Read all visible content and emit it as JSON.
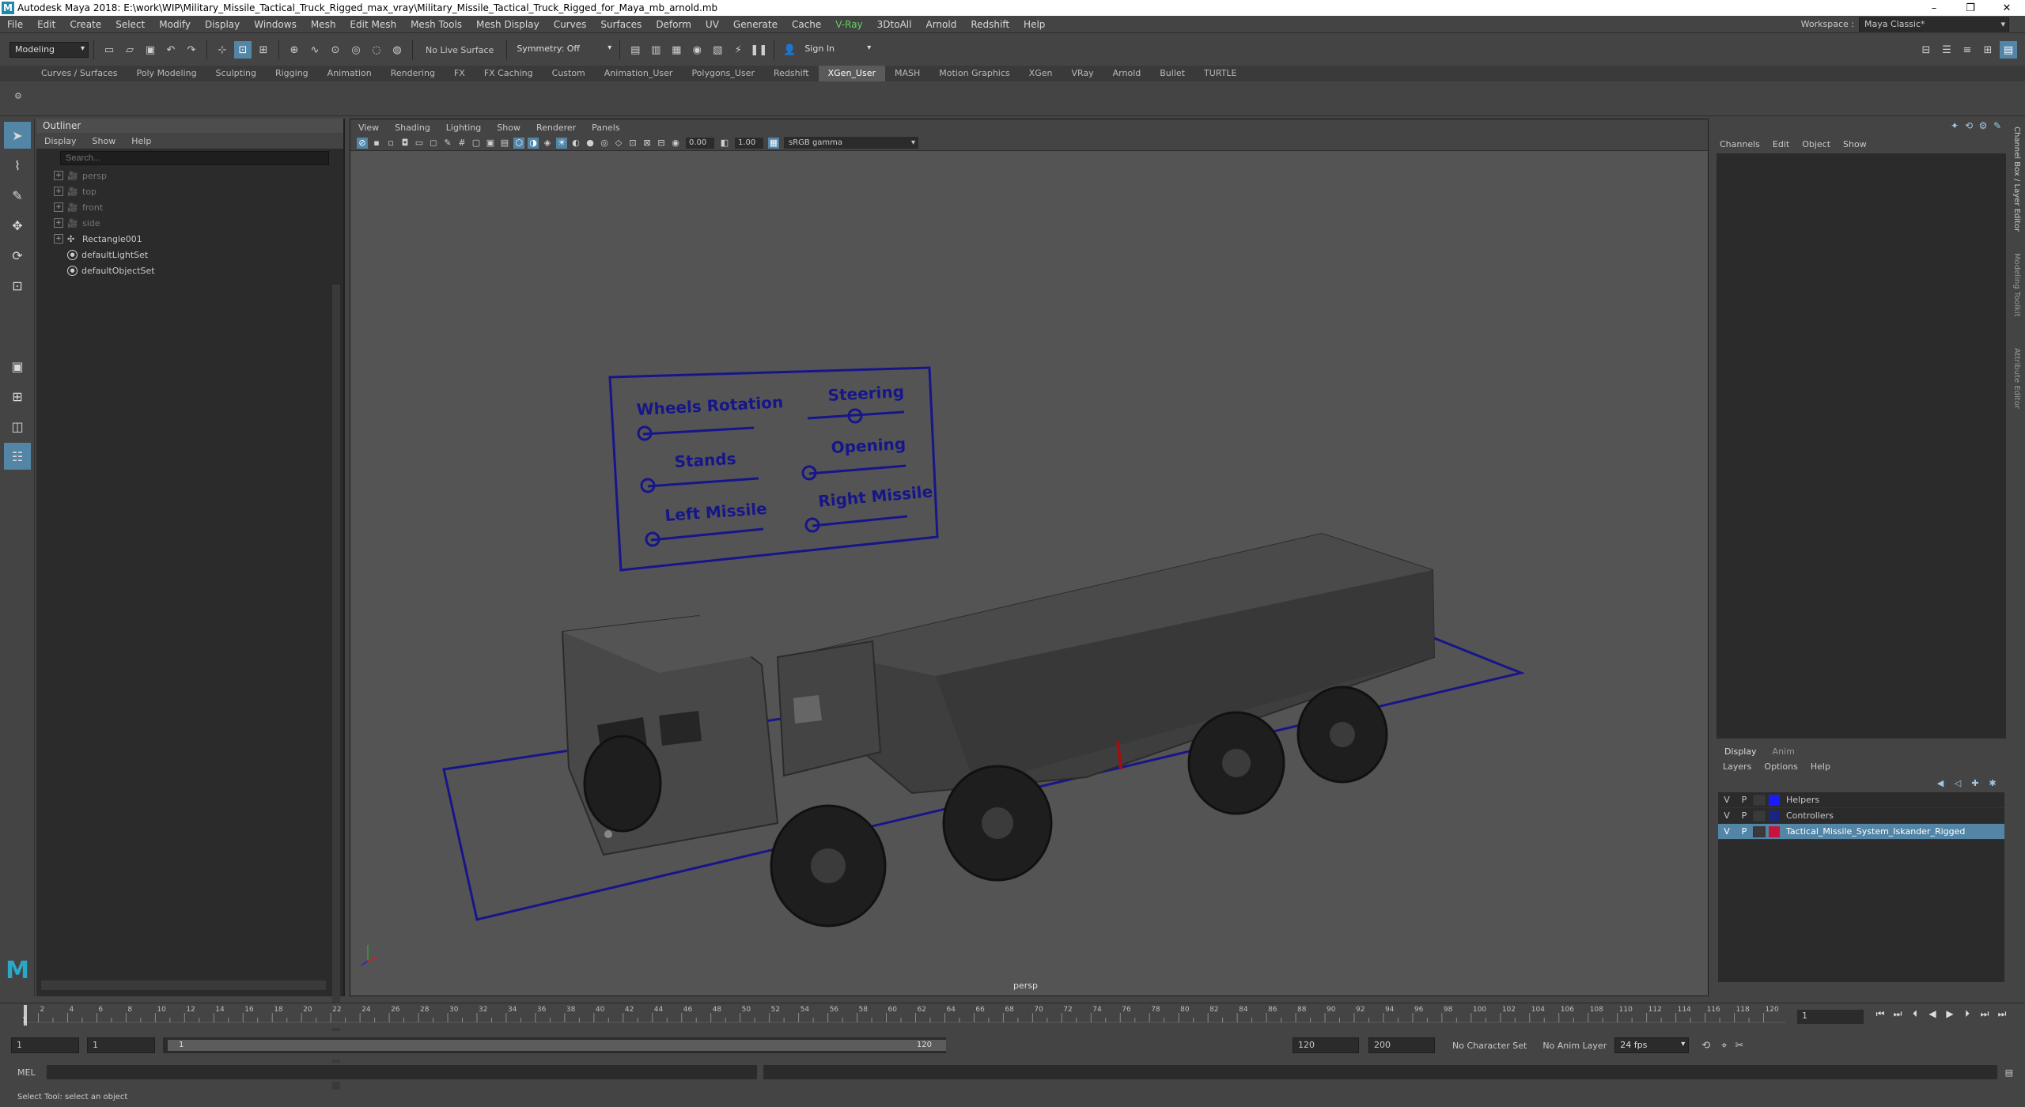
{
  "title_bar": {
    "app_icon": "M",
    "title": "Autodesk Maya 2018: E:\\work\\WIP\\Military_Missile_Tactical_Truck_Rigged_max_vray\\Military_Missile_Tactical_Truck_Rigged_for_Maya_mb_arnold.mb",
    "minimize": "–",
    "maximize": "❐",
    "close": "✕"
  },
  "menu_bar": {
    "items": [
      "File",
      "Edit",
      "Create",
      "Select",
      "Modify",
      "Display",
      "Windows",
      "Mesh",
      "Edit Mesh",
      "Mesh Tools",
      "Mesh Display",
      "Curves",
      "Surfaces",
      "Deform",
      "UV",
      "Generate",
      "Cache",
      "V-Ray",
      "3DtoAll",
      "Arnold",
      "Redshift",
      "Help"
    ],
    "vray_label": "V-Ray",
    "workspace_label": "Workspace :",
    "workspace_value": "Maya Classic*"
  },
  "status_line": {
    "mode": "Modeling",
    "live_surface": "No Live Surface",
    "symmetry": "Symmetry: Off",
    "sign_in": "Sign In"
  },
  "shelf_tabs": [
    "Curves / Surfaces",
    "Poly Modeling",
    "Sculpting",
    "Rigging",
    "Animation",
    "Rendering",
    "FX",
    "FX Caching",
    "Custom",
    "Animation_User",
    "Polygons_User",
    "Redshift",
    "XGen_User",
    "MASH",
    "Motion Graphics",
    "XGen",
    "VRay",
    "Arnold",
    "Bullet",
    "TURTLE"
  ],
  "shelf_active": "XGen_User",
  "outliner": {
    "title": "Outliner",
    "menus": [
      "Display",
      "Show",
      "Help"
    ],
    "search_placeholder": "Search...",
    "nodes": [
      {
        "label": "persp",
        "type": "camera",
        "dim": true
      },
      {
        "label": "top",
        "type": "camera",
        "dim": true
      },
      {
        "label": "front",
        "type": "camera",
        "dim": true
      },
      {
        "label": "side",
        "type": "camera",
        "dim": true
      },
      {
        "label": "Rectangle001",
        "type": "transform",
        "dim": false
      },
      {
        "label": "defaultLightSet",
        "type": "set",
        "dim": false
      },
      {
        "label": "defaultObjectSet",
        "type": "set",
        "dim": false
      }
    ]
  },
  "viewport": {
    "menus": [
      "View",
      "Shading",
      "Lighting",
      "Show",
      "Renderer",
      "Panels"
    ],
    "exposure": "0.00",
    "gamma": "1.00",
    "color_space": "sRGB gamma",
    "camera": "persp",
    "control_labels": [
      "Wheels Rotation",
      "Steering",
      "Stands",
      "Opening",
      "Left Missile",
      "Right Missile"
    ]
  },
  "channel_box": {
    "menus": [
      "Channels",
      "Edit",
      "Object",
      "Show"
    ],
    "side_tabs": [
      "Channel Box / Layer Editor",
      "Modeling Toolkit",
      "Attribute Editor"
    ]
  },
  "layer_editor": {
    "tabs": [
      "Display",
      "Anim"
    ],
    "menus": [
      "Layers",
      "Options",
      "Help"
    ],
    "layers": [
      {
        "v": "V",
        "p": "P",
        "name": "Helpers",
        "color": "#1a1aff",
        "selected": false
      },
      {
        "v": "V",
        "p": "P",
        "name": "Controllers",
        "color": "#1a2580",
        "selected": false
      },
      {
        "v": "V",
        "p": "P",
        "name": "Tactical_Missile_System_Iskander_Rigged",
        "color": "#c8143c",
        "selected": true
      }
    ]
  },
  "time_slider": {
    "ticks": [
      2,
      4,
      6,
      8,
      10,
      12,
      14,
      16,
      18,
      20,
      22,
      24,
      26,
      28,
      30,
      32,
      34,
      36,
      38,
      40,
      42,
      44,
      46,
      48,
      50,
      52,
      54,
      56,
      58,
      60,
      62,
      64,
      66,
      68,
      70,
      72,
      74,
      76,
      78,
      80,
      82,
      84,
      86,
      88,
      90,
      92,
      94,
      96,
      98,
      100,
      102,
      104,
      106,
      108,
      110,
      112,
      114,
      116,
      118,
      120
    ],
    "start_label": "1",
    "current_frame": "1"
  },
  "range_slider": {
    "start": "1",
    "playback_start": "1",
    "range_start_label": "1",
    "range_end_label": "120",
    "playback_end": "120",
    "end": "200",
    "character_set": "No Character Set",
    "anim_layer": "No Anim Layer",
    "fps": "24 fps"
  },
  "command_line": {
    "label": "MEL"
  },
  "help_line": {
    "text": "Select Tool: select an object"
  },
  "colors": {
    "accent": "#5285a6",
    "rig_outline": "#1a1a8c",
    "vray_green": "#5fd35f"
  }
}
